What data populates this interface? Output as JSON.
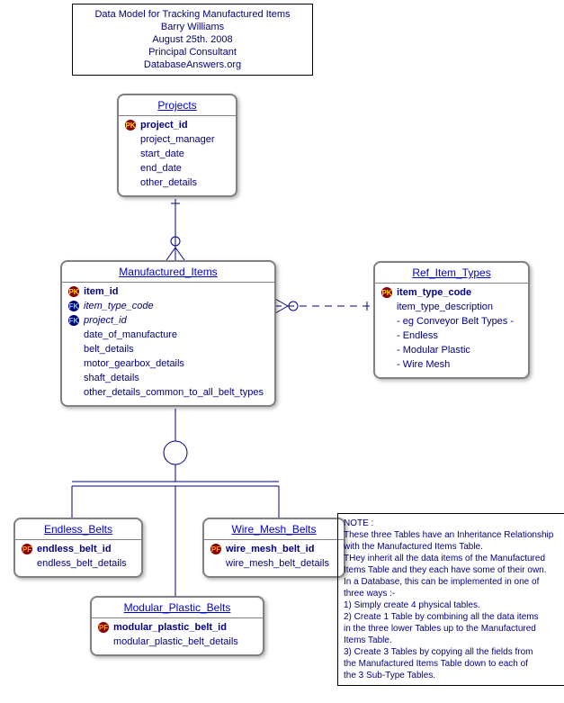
{
  "title_box": {
    "line1": "Data Model for Tracking Manufactured Items",
    "line2": "Barry Williams",
    "line3": "August 25th. 2008",
    "line4": "Principal Consultant",
    "line5": "DatabaseAnswers.org"
  },
  "entities": {
    "projects": {
      "title": "Projects",
      "fields": {
        "pk": "project_id",
        "f1": "project_manager",
        "f2": "start_date",
        "f3": "end_date",
        "f4": "other_details"
      }
    },
    "manufactured_items": {
      "title": "Manufactured_Items",
      "fields": {
        "pk": "item_id",
        "fk1": "item_type_code",
        "fk2": "project_id",
        "f1": "date_of_manufacture",
        "f2": "belt_details",
        "f3": "motor_gearbox_details",
        "f4": "shaft_details",
        "f5": "other_details_common_to_all_belt_types"
      }
    },
    "ref_item_types": {
      "title": "Ref_Item_Types",
      "fields": {
        "pk": "item_type_code",
        "f1": "item_type_description",
        "f2": "- eg Conveyor Belt Types -",
        "f3": "- Endless",
        "f4": "- Modular Plastic",
        "f5": "- Wire Mesh"
      }
    },
    "endless_belts": {
      "title": "Endless_Belts",
      "fields": {
        "pf": "endless_belt_id",
        "f1": "endless_belt_details"
      }
    },
    "wire_mesh_belts": {
      "title": "Wire_Mesh_Belts",
      "fields": {
        "pf": "wire_mesh_belt_id",
        "f1": "wire_mesh_belt_details"
      }
    },
    "modular_plastic_belts": {
      "title": "Modular_Plastic_Belts",
      "fields": {
        "pf": "modular_plastic_belt_id",
        "f1": "modular_plastic_belt_details"
      }
    }
  },
  "note": {
    "l0": " NOTE :",
    "l1": "These three Tables have an Inheritance Relationship",
    "l2": "with the Manufactured Items Table.",
    "l3": "THey inherit all the data items of the Manufactured",
    "l4": "Items Table and they each have some of their own.",
    "l5": "In a Database, this can be implemented in one of",
    "l6": "three ways :-",
    "l7": "1) Simply create 4 physical tables.",
    "l8": "2) Create 1 Table by combining all the data items",
    "l9": "    in the three lower Tables up to the Manufactured",
    "l10": "    Items Table.",
    "l11": "3) Create 3 Tables by copying all the fields from",
    "l12": "    the Manufactured Items Table down to each of",
    "l13": "    the 3 Sub-Type Tables."
  }
}
